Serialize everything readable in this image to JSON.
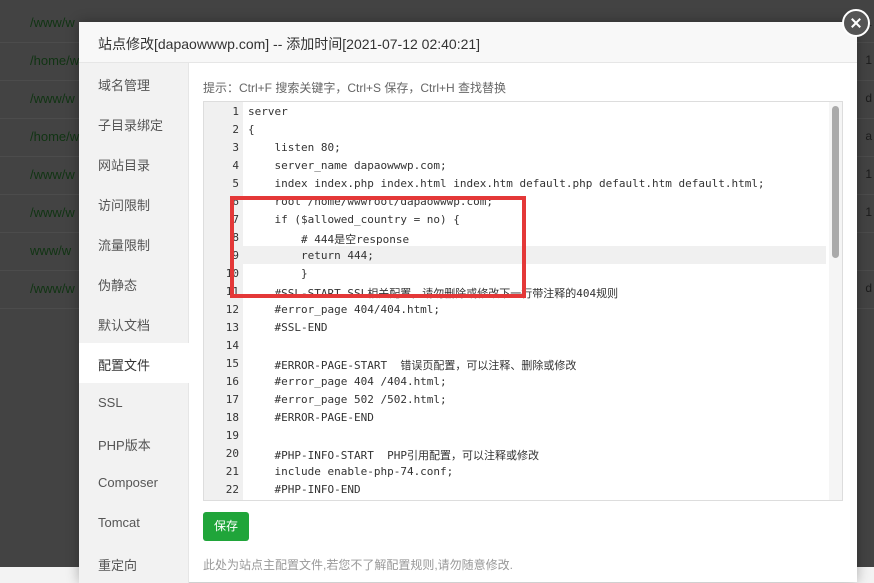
{
  "background_rows": [
    {
      "path": "/www/w",
      "right": "1"
    },
    {
      "path": "/home/w",
      "right": "1"
    },
    {
      "path": "/www/w",
      "right": "d"
    },
    {
      "path": "/home/w",
      "right": "a"
    },
    {
      "path": "/www/w",
      "right": "1"
    },
    {
      "path": "/www/w",
      "right": "1"
    },
    {
      "path": "www/w",
      "right": ""
    },
    {
      "path": "/www/w",
      "right": "d"
    }
  ],
  "dialog": {
    "title": "站点修改[dapaowwwp.com] -- 添加时间[2021-07-12 02:40:21]"
  },
  "sidebar": {
    "items": [
      {
        "label": "域名管理"
      },
      {
        "label": "子目录绑定"
      },
      {
        "label": "网站目录"
      },
      {
        "label": "访问限制"
      },
      {
        "label": "流量限制"
      },
      {
        "label": "伪静态"
      },
      {
        "label": "默认文档"
      },
      {
        "label": "配置文件"
      },
      {
        "label": "SSL"
      },
      {
        "label": "PHP版本"
      },
      {
        "label": "Composer"
      },
      {
        "label": "Tomcat"
      },
      {
        "label": "重定向"
      }
    ],
    "active": "配置文件"
  },
  "editor": {
    "tip": "提示：Ctrl+F 搜索关键字，Ctrl+S 保存，Ctrl+H 查找替换",
    "lines": [
      {
        "num": "1",
        "text": "server"
      },
      {
        "num": "2",
        "text": "{"
      },
      {
        "num": "3",
        "text": "    listen 80;"
      },
      {
        "num": "4",
        "text": "    server_name dapaowwwp.com;"
      },
      {
        "num": "5",
        "text": "    index index.php index.html index.htm default.php default.htm default.html;"
      },
      {
        "num": "6",
        "text": "    root /home/wwwroot/dapaowwwp.com;"
      },
      {
        "num": "7",
        "text": "    if ($allowed_country = no) {"
      },
      {
        "num": "8",
        "text": "        # 444是空response"
      },
      {
        "num": "9",
        "text": "        return 444;"
      },
      {
        "num": "10",
        "text": "        }"
      },
      {
        "num": "11",
        "text": "    #SSL-START SSL相关配置，请勿删除或修改下一行带注释的404规则"
      },
      {
        "num": "12",
        "text": "    #error_page 404/404.html;"
      },
      {
        "num": "13",
        "text": "    #SSL-END"
      },
      {
        "num": "14",
        "text": ""
      },
      {
        "num": "15",
        "text": "    #ERROR-PAGE-START  错误页配置，可以注释、删除或修改"
      },
      {
        "num": "16",
        "text": "    #error_page 404 /404.html;"
      },
      {
        "num": "17",
        "text": "    #error_page 502 /502.html;"
      },
      {
        "num": "18",
        "text": "    #ERROR-PAGE-END"
      },
      {
        "num": "19",
        "text": ""
      },
      {
        "num": "20",
        "text": "    #PHP-INFO-START  PHP引用配置，可以注释或修改"
      },
      {
        "num": "21",
        "text": "    include enable-php-74.conf;"
      },
      {
        "num": "22",
        "text": "    #PHP-INFO-END"
      }
    ]
  },
  "save_label": "保存",
  "note": "此处为站点主配置文件,若您不了解配置规则,请勿随意修改.",
  "colors": {
    "save": "#20a53a",
    "highlight": "#e43838"
  }
}
